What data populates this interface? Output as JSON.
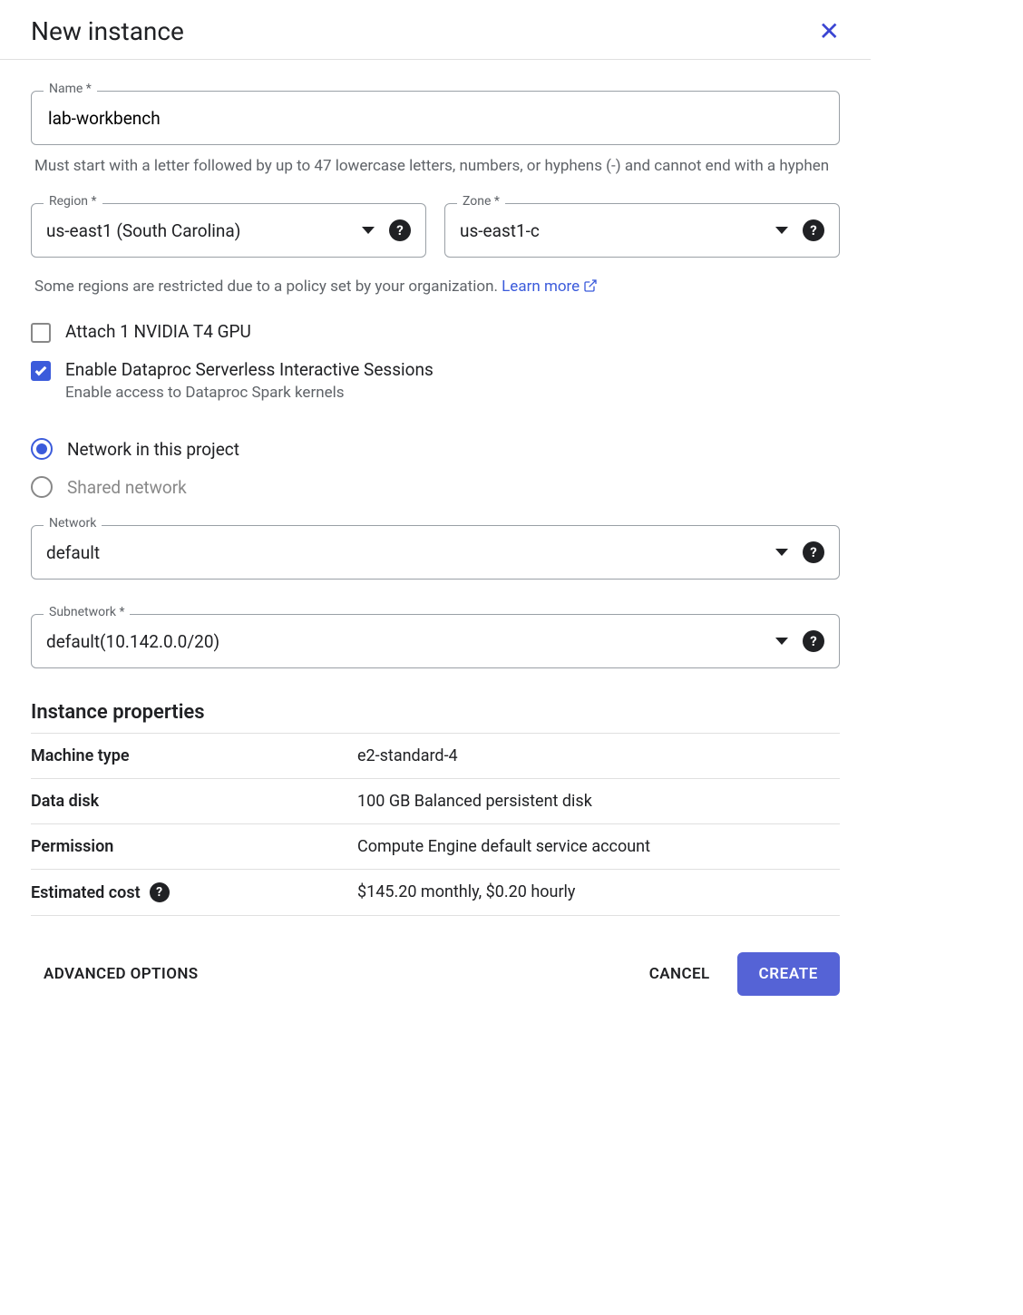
{
  "dialog": {
    "title": "New instance"
  },
  "name": {
    "label": "Name *",
    "value": "lab-workbench",
    "helper": "Must start with a letter followed by up to 47 lowercase letters, numbers, or hyphens (-) and cannot end with a hyphen"
  },
  "region": {
    "label": "Region *",
    "value": "us-east1 (South Carolina)"
  },
  "zone": {
    "label": "Zone *",
    "value": "us-east1-c"
  },
  "region_notice": {
    "text": "Some regions are restricted due to a policy set by your organization. ",
    "link": "Learn more"
  },
  "gpu_checkbox": {
    "label": "Attach 1 NVIDIA T4 GPU",
    "checked": false
  },
  "dataproc_checkbox": {
    "label": "Enable Dataproc Serverless Interactive Sessions",
    "sublabel": "Enable access to Dataproc Spark kernels",
    "checked": true
  },
  "network_radio": {
    "option1": "Network in this project",
    "option2": "Shared network",
    "selected": "option1"
  },
  "network": {
    "label": "Network",
    "value": "default"
  },
  "subnetwork": {
    "label": "Subnetwork *",
    "value": "default(10.142.0.0/20)"
  },
  "props": {
    "heading": "Instance properties",
    "rows": [
      {
        "key": "Machine type",
        "val": "e2-standard-4"
      },
      {
        "key": "Data disk",
        "val": "100 GB Balanced persistent disk"
      },
      {
        "key": "Permission",
        "val": "Compute Engine default service account"
      },
      {
        "key": "Estimated cost",
        "val": "$145.20 monthly, $0.20 hourly",
        "help": true
      }
    ]
  },
  "footer": {
    "advanced": "ADVANCED OPTIONS",
    "cancel": "CANCEL",
    "create": "CREATE"
  }
}
